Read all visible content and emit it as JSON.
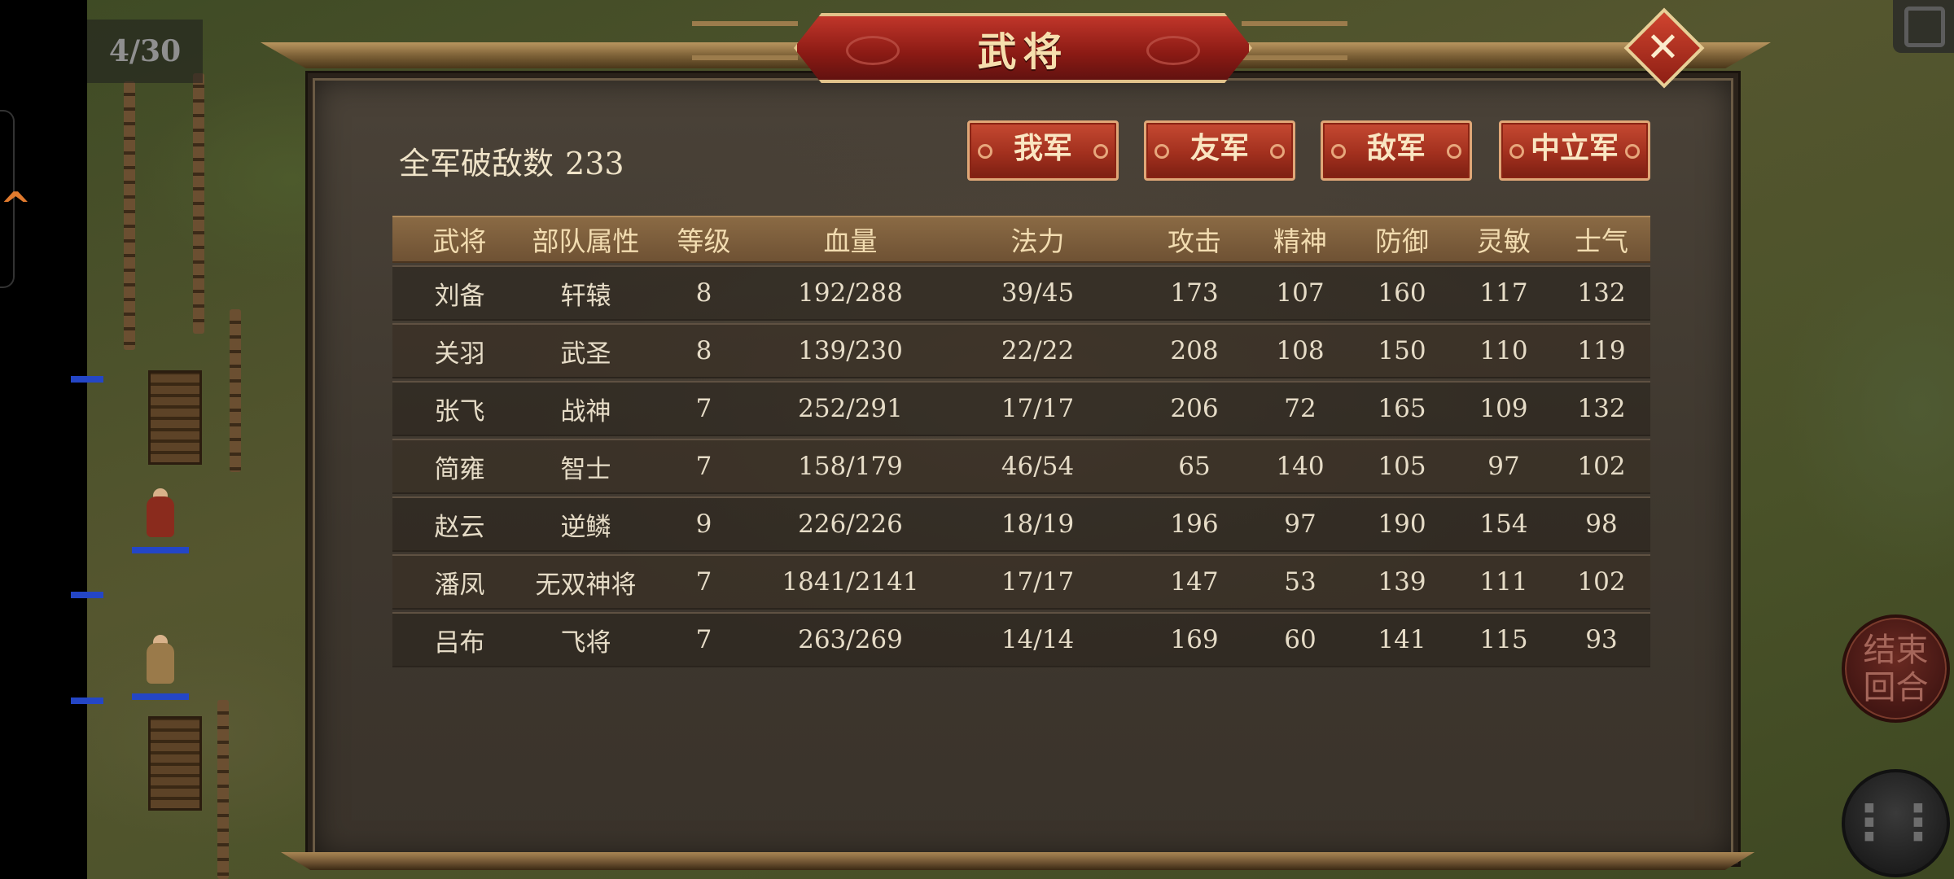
{
  "game": {
    "turn_counter": "4/30",
    "end_turn_label": [
      "结束",
      "回合"
    ],
    "menu_icon": "menu-lines-icon"
  },
  "dialog": {
    "title": "武将",
    "close_icon": "close-icon",
    "total_kills_label": "全军破敌数",
    "total_kills_value": "233",
    "tabs": [
      {
        "label": "我军",
        "selected": true
      },
      {
        "label": "友军",
        "selected": false
      },
      {
        "label": "敌军",
        "selected": false
      },
      {
        "label": "中立军",
        "selected": false
      }
    ],
    "table": {
      "headers": [
        "武将",
        "部队属性",
        "等级",
        "血量",
        "法力",
        "攻击",
        "精神",
        "防御",
        "灵敏",
        "士气"
      ],
      "rows": [
        [
          "刘备",
          "轩辕",
          "8",
          "192/288",
          "39/45",
          "173",
          "107",
          "160",
          "117",
          "132"
        ],
        [
          "关羽",
          "武圣",
          "8",
          "139/230",
          "22/22",
          "208",
          "108",
          "150",
          "110",
          "119"
        ],
        [
          "张飞",
          "战神",
          "7",
          "252/291",
          "17/17",
          "206",
          "72",
          "165",
          "109",
          "132"
        ],
        [
          "简雍",
          "智士",
          "7",
          "158/179",
          "46/54",
          "65",
          "140",
          "105",
          "97",
          "102"
        ],
        [
          "赵云",
          "逆鳞",
          "9",
          "226/226",
          "18/19",
          "196",
          "97",
          "190",
          "154",
          "98"
        ],
        [
          "潘凤",
          "无双神将",
          "7",
          "1841/2141",
          "17/17",
          "147",
          "53",
          "139",
          "111",
          "102"
        ],
        [
          "吕布",
          "飞将",
          "7",
          "263/269",
          "14/14",
          "169",
          "60",
          "141",
          "115",
          "93"
        ]
      ]
    }
  },
  "colors": {
    "panel_bg": "#3f382f",
    "header_bg": "#7a5c3a",
    "tab_red": "#b23a26",
    "title_red": "#9c231a",
    "gold_trim": "#e2c28a",
    "text_light": "#e6dcc7"
  }
}
